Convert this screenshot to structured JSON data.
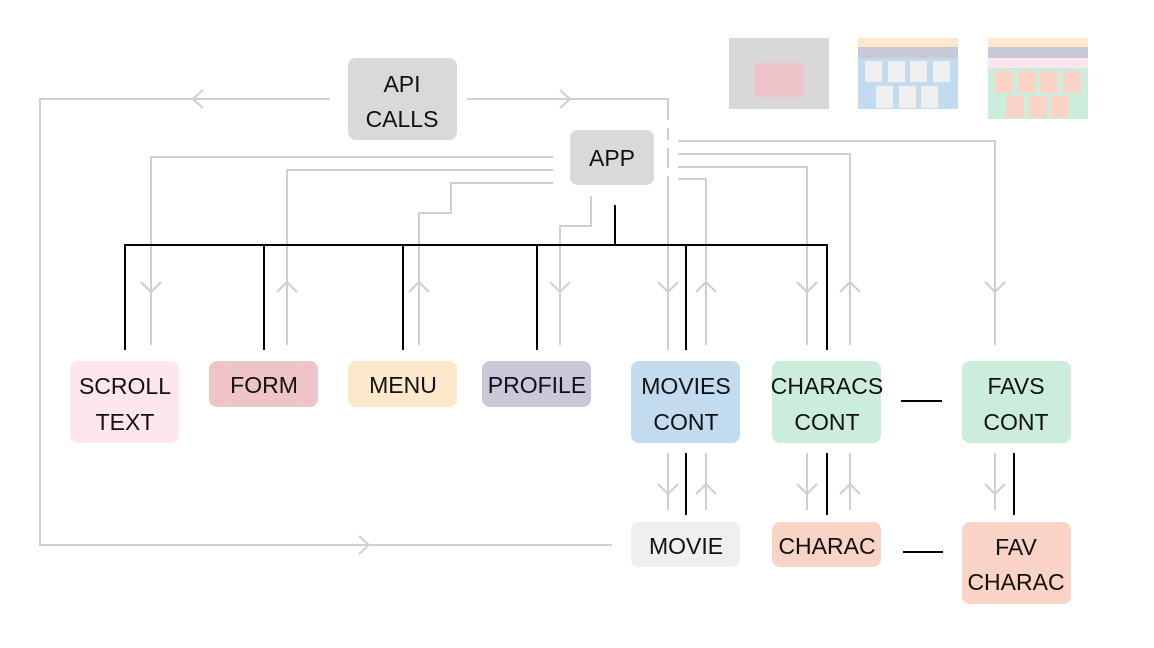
{
  "nodes": {
    "api_calls": {
      "line1": "API",
      "line2": "CALLS",
      "color": "#d9d9d9"
    },
    "app": {
      "label": "APP",
      "color": "#d9d9d9"
    },
    "scroll_text": {
      "line1": "SCROLL",
      "line2": "TEXT",
      "color": "#fde6ee"
    },
    "form": {
      "label": "FORM",
      "color": "#eec4c9"
    },
    "menu": {
      "label": "MENU",
      "color": "#fde8cc"
    },
    "profile": {
      "label": "PROFILE",
      "color": "#c8c8d8"
    },
    "movies_cont": {
      "line1": "MOVIES",
      "line2": "CONT",
      "color": "#c3dbee"
    },
    "characs_cont": {
      "line1": "CHARACS",
      "line2": "CONT",
      "color": "#ccecdc"
    },
    "favs_cont": {
      "line1": "FAVS",
      "line2": "CONT",
      "color": "#ccecdc"
    },
    "movie": {
      "label": "MOVIE",
      "color": "#efefef"
    },
    "charac": {
      "label": "CHARAC",
      "color": "#f9d3c5"
    },
    "fav_charac": {
      "line1": "FAV",
      "line2": "CHARAC",
      "color": "#f9d3c5"
    }
  },
  "colors": {
    "hierarchy_line": "#000000",
    "data_flow_line": "#cfcfcf"
  }
}
